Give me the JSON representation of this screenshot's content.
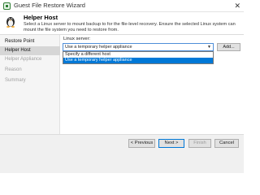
{
  "window": {
    "title": "Guest File Restore Wizard",
    "close_glyph": "✕"
  },
  "header": {
    "title": "Helper Host",
    "description": "Select a Linux server to mount backup to for the file-level recovery. Ensure the selected Linux system can mount the file system you need to restore from."
  },
  "sidebar": {
    "items": [
      {
        "label": "Restore Point",
        "state": "done"
      },
      {
        "label": "Helper Host",
        "state": "active"
      },
      {
        "label": "Helper Appliance",
        "state": "pending"
      },
      {
        "label": "Reason",
        "state": "pending"
      },
      {
        "label": "Summary",
        "state": "pending"
      }
    ]
  },
  "form": {
    "server_label": "Linux server:",
    "server_value": "Use a temporary helper appliance",
    "add_label": "Add...",
    "options": [
      {
        "label": "Specify a different host",
        "selected": false
      },
      {
        "label": "Use a temporary helper appliance",
        "selected": true
      }
    ]
  },
  "footer": {
    "previous_label": "< Previous",
    "next_label": "Next >",
    "finish_label": "Finish",
    "cancel_label": "Cancel"
  },
  "colors": {
    "accent": "#0078d7",
    "sidebar_active": "#d6d6d6",
    "footer_bg": "#f0f0f0"
  },
  "icons": {
    "title": "wizard-app-icon",
    "header": "linux-penguin-icon",
    "dropdown": "chevron-down-icon"
  }
}
